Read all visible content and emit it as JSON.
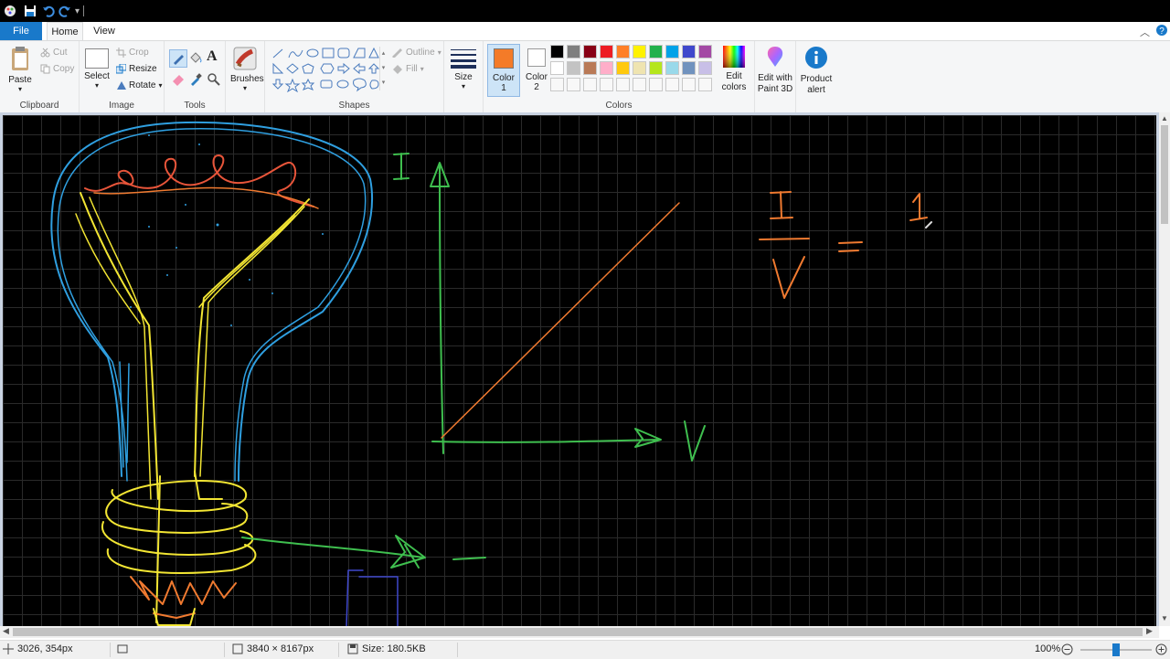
{
  "tabs": {
    "file": "File",
    "home": "Home",
    "view": "View"
  },
  "clipboard": {
    "group": "Clipboard",
    "paste": "Paste",
    "cut": "Cut",
    "copy": "Copy"
  },
  "image": {
    "group": "Image",
    "select": "Select",
    "crop": "Crop",
    "resize": "Resize",
    "rotate": "Rotate"
  },
  "tools": {
    "group": "Tools"
  },
  "brushes": {
    "label": "Brushes"
  },
  "shapes": {
    "group": "Shapes",
    "outline": "Outline",
    "fill": "Fill"
  },
  "size": {
    "label": "Size"
  },
  "colors": {
    "group": "Colors",
    "color1_label": "Color",
    "color1_num": "1",
    "color2_label": "Color",
    "color2_num": "2",
    "color1_value": "#f47b28",
    "color2_value": "#ffffff",
    "edit_label1": "Edit",
    "edit_label2": "colors",
    "palette_row1": [
      "#000000",
      "#7f7f7f",
      "#880015",
      "#ed1c24",
      "#ff7f27",
      "#fff200",
      "#22b14c",
      "#00a2e8",
      "#3f48cc",
      "#a349a4"
    ],
    "palette_row2": [
      "#ffffff",
      "#c3c3c3",
      "#b97a57",
      "#ffaec9",
      "#ffc90e",
      "#efe4b0",
      "#b5e61d",
      "#99d9ea",
      "#7092be",
      "#c8bfe7"
    ],
    "palette_row3": [
      "#f8f8f8",
      "#f8f8f8",
      "#f8f8f8",
      "#f8f8f8",
      "#f8f8f8",
      "#f8f8f8",
      "#f8f8f8",
      "#f8f8f8",
      "#f8f8f8",
      "#f8f8f8"
    ]
  },
  "paint3d": {
    "line1": "Edit with",
    "line2": "Paint 3D"
  },
  "product_alert": {
    "line1": "Product",
    "line2": "alert"
  },
  "drawing": {
    "label_I": "I",
    "label_V": "V",
    "eq_num": "I",
    "eq_den": "V",
    "eq_sign": "=",
    "eq_rhs": "1",
    "dash": "—"
  },
  "status": {
    "cursor_pos": "3026, 354px",
    "dimensions": "3840 × 8167px",
    "file_size": "Size: 180.5KB",
    "zoom": "100%",
    "zoom_level": 0.5
  }
}
